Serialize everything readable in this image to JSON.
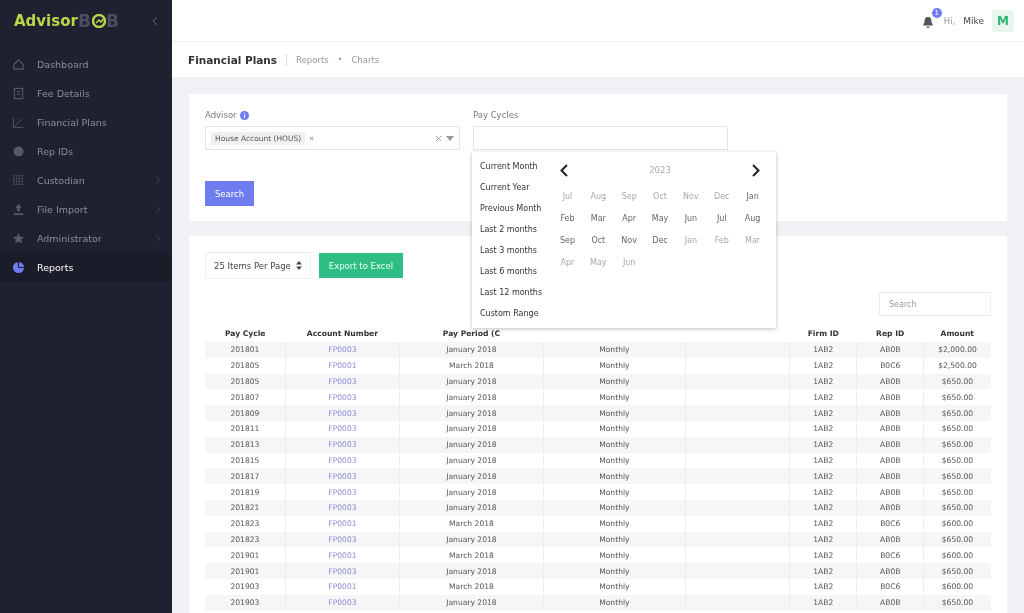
{
  "sidebar": {
    "logo": {
      "first": "Advisor",
      "second": "B",
      "mark": "B"
    },
    "items": [
      {
        "label": "Dashboard",
        "submenu": false,
        "selected": false
      },
      {
        "label": "Fee Details",
        "submenu": false,
        "selected": false
      },
      {
        "label": "Financial Plans",
        "submenu": false,
        "selected": false
      },
      {
        "label": "Rep IDs",
        "submenu": false,
        "selected": false
      },
      {
        "label": "Custodian",
        "submenu": true,
        "selected": false
      },
      {
        "label": "File Import",
        "submenu": true,
        "selected": false
      },
      {
        "label": "Administrator",
        "submenu": true,
        "selected": false
      },
      {
        "label": "Reports",
        "submenu": false,
        "selected": true
      }
    ]
  },
  "header": {
    "notifications": "1",
    "greeting": "Hi,",
    "user": "Mike",
    "avatar": "M"
  },
  "page": {
    "title": "Financial Plans",
    "breadcrumb": [
      "Reports",
      "•",
      "Charts"
    ]
  },
  "filters": {
    "advisor_label": "Advisor",
    "advisor_tag": "House Account (HOUS)",
    "pay_cycles_label": "Pay Cycles",
    "search_button": "Search"
  },
  "dropdown": {
    "ranges": [
      "Current Month",
      "Current Year",
      "Previous Month",
      "Last 2 months",
      "Last 3 months",
      "Last 6 months",
      "Last 12 months",
      "Custom Range"
    ],
    "year": "2023",
    "months": [
      {
        "label": "Jul",
        "disabled": true
      },
      {
        "label": "Aug",
        "disabled": true
      },
      {
        "label": "Sep",
        "disabled": true
      },
      {
        "label": "Oct",
        "disabled": true
      },
      {
        "label": "Nov",
        "disabled": true
      },
      {
        "label": "Dec",
        "disabled": true
      },
      {
        "label": "Jan",
        "disabled": false
      },
      {
        "label": "Feb",
        "disabled": false
      },
      {
        "label": "Mar",
        "disabled": false
      },
      {
        "label": "Apr",
        "disabled": false
      },
      {
        "label": "May",
        "disabled": false
      },
      {
        "label": "Jun",
        "disabled": false
      },
      {
        "label": "Jul",
        "disabled": false
      },
      {
        "label": "Aug",
        "disabled": false
      },
      {
        "label": "Sep",
        "disabled": false
      },
      {
        "label": "Oct",
        "disabled": false
      },
      {
        "label": "Nov",
        "disabled": false
      },
      {
        "label": "Dec",
        "disabled": false
      },
      {
        "label": "Jan",
        "disabled": true
      },
      {
        "label": "Feb",
        "disabled": true
      },
      {
        "label": "Mar",
        "disabled": true
      },
      {
        "label": "Apr",
        "disabled": true
      },
      {
        "label": "May",
        "disabled": true
      },
      {
        "label": "Jun",
        "disabled": true
      }
    ]
  },
  "table_controls": {
    "page_size": "25 Items Per Page",
    "export_button": "Export to Excel",
    "search_placeholder": "Search"
  },
  "table": {
    "columns": [
      {
        "label": "Pay Cycle"
      },
      {
        "label": "Account Number"
      },
      {
        "label": "Pay Period (C"
      },
      {},
      {},
      {
        "label": "Firm ID"
      },
      {
        "label": "Rep ID"
      },
      {
        "label": "Amount"
      }
    ],
    "rows": [
      [
        "201801",
        "FP0003",
        "January 2018",
        "Monthly",
        "",
        "1AB2",
        "AB0B",
        "$2,000.00"
      ],
      [
        "201805",
        "FP0001",
        "March 2018",
        "Monthly",
        "",
        "1AB2",
        "B0C6",
        "$2,500.00"
      ],
      [
        "201805",
        "FP0003",
        "January 2018",
        "Monthly",
        "",
        "1AB2",
        "AB0B",
        "$650.00"
      ],
      [
        "201807",
        "FP0003",
        "January 2018",
        "Monthly",
        "",
        "1AB2",
        "AB0B",
        "$650.00"
      ],
      [
        "201809",
        "FP0003",
        "January 2018",
        "Monthly",
        "",
        "1AB2",
        "AB0B",
        "$650.00"
      ],
      [
        "201811",
        "FP0003",
        "January 2018",
        "Monthly",
        "",
        "1AB2",
        "AB0B",
        "$650.00"
      ],
      [
        "201813",
        "FP0003",
        "January 2018",
        "Monthly",
        "",
        "1AB2",
        "AB0B",
        "$650.00"
      ],
      [
        "201815",
        "FP0003",
        "January 2018",
        "Monthly",
        "",
        "1AB2",
        "AB0B",
        "$650.00"
      ],
      [
        "201817",
        "FP0003",
        "January 2018",
        "Monthly",
        "",
        "1AB2",
        "AB0B",
        "$650.00"
      ],
      [
        "201819",
        "FP0003",
        "January 2018",
        "Monthly",
        "",
        "1AB2",
        "AB0B",
        "$650.00"
      ],
      [
        "201821",
        "FP0003",
        "January 2018",
        "Monthly",
        "",
        "1AB2",
        "AB0B",
        "$650.00"
      ],
      [
        "201823",
        "FP0001",
        "March 2018",
        "Monthly",
        "",
        "1AB2",
        "B0C6",
        "$600.00"
      ],
      [
        "201823",
        "FP0003",
        "January 2018",
        "Monthly",
        "",
        "1AB2",
        "AB0B",
        "$650.00"
      ],
      [
        "201901",
        "FP0001",
        "March 2018",
        "Monthly",
        "",
        "1AB2",
        "B0C6",
        "$600.00"
      ],
      [
        "201901",
        "FP0003",
        "January 2018",
        "Monthly",
        "",
        "1AB2",
        "AB0B",
        "$650.00"
      ],
      [
        "201903",
        "FP0001",
        "March 2018",
        "Monthly",
        "",
        "1AB2",
        "B0C6",
        "$600.00"
      ],
      [
        "201903",
        "FP0003",
        "January 2018",
        "Monthly",
        "",
        "1AB2",
        "AB0B",
        "$650.00"
      ]
    ]
  }
}
